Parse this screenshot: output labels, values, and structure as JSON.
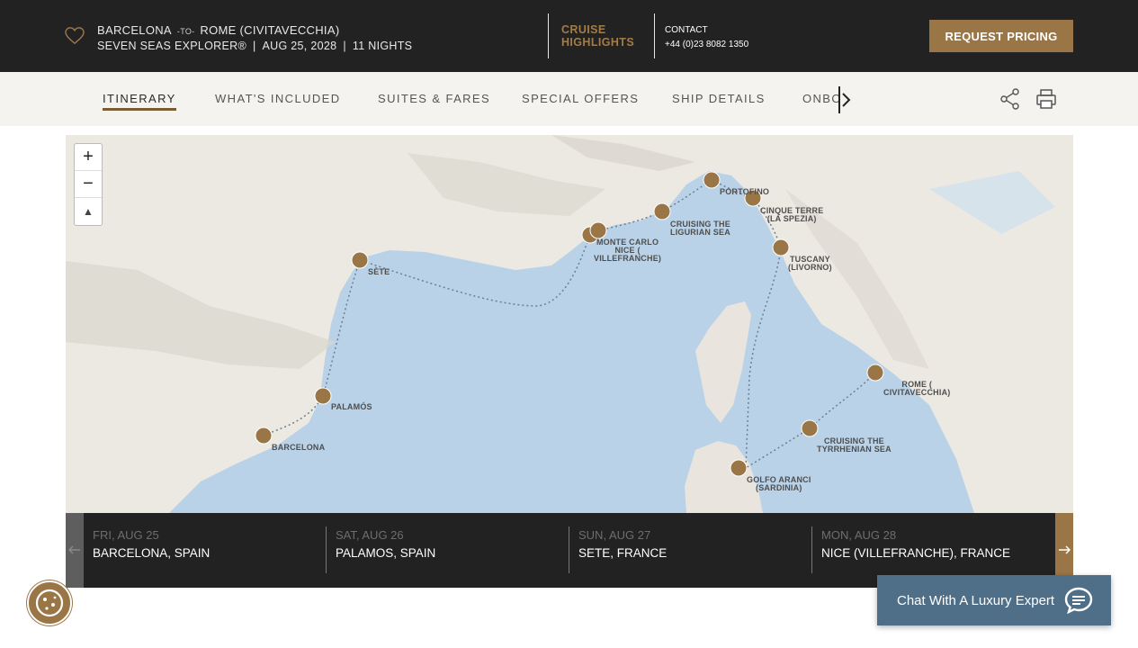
{
  "header": {
    "origin": "BARCELONA",
    "to_word": "-TO-",
    "destination": "ROME (CIVITAVECCHIA)",
    "ship": "SEVEN SEAS EXPLORER®",
    "date": "AUG 25, 2028",
    "nights": "11 NIGHTS",
    "highlights_line1": "CRUISE",
    "highlights_line2": "HIGHLIGHTS",
    "contact_label": "CONTACT",
    "contact_phone": "+44 (0)23 8082 1350",
    "pricing_button": "REQUEST PRICING",
    "accent_color": "#9a7647"
  },
  "tabs": [
    {
      "label": "ITINERARY",
      "active": true
    },
    {
      "label": "WHAT'S INCLUDED"
    },
    {
      "label": "SUITES & FARES"
    },
    {
      "label": "SPECIAL OFFERS"
    },
    {
      "label": "SHIP DETAILS"
    },
    {
      "label": "ONBOARD"
    }
  ],
  "map": {
    "zoom_in": "+",
    "zoom_out": "−",
    "compass": "▲",
    "labels": {
      "barcelona": "BARCELONA",
      "palamos": "PALAMÓS",
      "sete": "SÈTE",
      "monte_carlo": "MONTE CARLO",
      "nice_1": "NICE (",
      "nice_2": "VILLEFRANCHE)",
      "ligurian_1": "CRUISING THE",
      "ligurian_2": "LIGURIAN SEA",
      "portofino": "PORTOFINO",
      "cinque_1": "CINQUE TERRE",
      "cinque_2": "(LA SPEZIA)",
      "tuscany_1": "TUSCANY",
      "tuscany_2": "(LIVORNO)",
      "rome_1": "ROME (",
      "rome_2": "CIVITAVECCHIA)",
      "tyrr_1": "CRUISING THE",
      "tyrr_2": "TYRRHENIAN SEA",
      "golfo_1": "GOLFO ARANCI",
      "golfo_2": "(SARDINIA)"
    }
  },
  "days": [
    {
      "date": "FRI, AUG 25",
      "port": "BARCELONA, SPAIN"
    },
    {
      "date": "SAT, AUG 26",
      "port": "PALAMOS, SPAIN"
    },
    {
      "date": "SUN, AUG 27",
      "port": "SETE, FRANCE"
    },
    {
      "date": "MON, AUG 28",
      "port": "NICE (VILLEFRANCHE), FRANCE"
    }
  ],
  "chat": {
    "label": "Chat With A Luxury Expert"
  }
}
